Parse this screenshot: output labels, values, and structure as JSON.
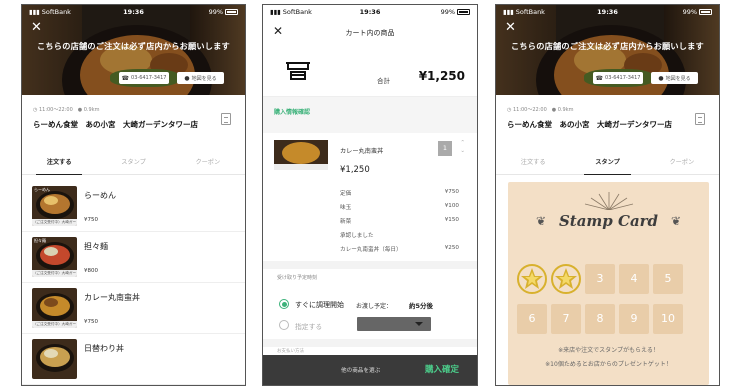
{
  "status_bar": {
    "carrier": "SoftBank",
    "time": "19:36",
    "battery": "99%"
  },
  "shop": {
    "notice": "こちらの店舗のご注文は必ず店内からお願いします",
    "phone": "03-6417-3417",
    "map_label": "地図を見る",
    "hours": "11:00～22:00",
    "distance": "0.9km",
    "name": "らーめん食堂　あの小宮　大崎ガーデンタワー店"
  },
  "tabs": [
    "注文する",
    "スタンプ",
    "クーポン"
  ],
  "menu_items": [
    {
      "name": "らーめん",
      "price": "¥750",
      "thumb_tag": "らーめん",
      "thumb_label": "〈ご注文受付中〉大崎ガーデンタワー"
    },
    {
      "name": "担々麺",
      "price": "¥800",
      "thumb_tag": "担々麺",
      "thumb_label": "〈ご注文受付中〉大崎ガーデンタワー"
    },
    {
      "name": "カレー丸南蛮丼",
      "price": "¥750",
      "thumb_tag": "",
      "thumb_label": "〈ご注文受付中〉大崎ガーデンタワー"
    },
    {
      "name": "日替わり丼",
      "price": "",
      "thumb_tag": "",
      "thumb_label": ""
    }
  ],
  "cart": {
    "title": "カート内の商品",
    "total_label": "合計",
    "total_value": "¥1,250",
    "section_label": "購入情報確認",
    "item": {
      "name": "カレー丸南蛮丼",
      "qty": "1",
      "price": "¥1,250",
      "lines": [
        {
          "label": "定価",
          "value": "¥750"
        },
        {
          "label": "味玉",
          "value": "¥100"
        },
        {
          "label": "新菜",
          "value": "¥150"
        }
      ],
      "note": "承認しました",
      "daily": {
        "label": "カレー丸南蛮丼（毎日）",
        "value": "¥250"
      }
    },
    "pickup_label": "受け取り予定時刻",
    "option_immediate": "すぐに調理開始",
    "estimate_label": "お渡し予定：",
    "estimate_value": "約5分後",
    "option_specify": "指定する",
    "payment_label": "お支払い方法",
    "other_items": "他の商品を選ぶ",
    "confirm": "購入確定"
  },
  "stamp": {
    "title": "Stamp Card",
    "slots": [
      "1",
      "2",
      "3",
      "4",
      "5",
      "6",
      "7",
      "8",
      "9",
      "10"
    ],
    "stamped_count": 2,
    "note1": "※来店や注文でスタンプがもらえる！",
    "note2": "※10個ためるとお店からのプレゼントゲット！"
  },
  "colors": {
    "accent_green": "#3cb27a",
    "stamp_bg": "#f3dfc6",
    "stamp_slot": "#e9cda9",
    "stamp_gold": "#d8b12e"
  },
  "icons": [
    "close-icon",
    "phone-icon",
    "map-pin-icon",
    "clock-icon",
    "menu-doc-icon",
    "shop-logo-icon",
    "radio-icon",
    "caret-down-icon",
    "stamp-star-icon"
  ]
}
